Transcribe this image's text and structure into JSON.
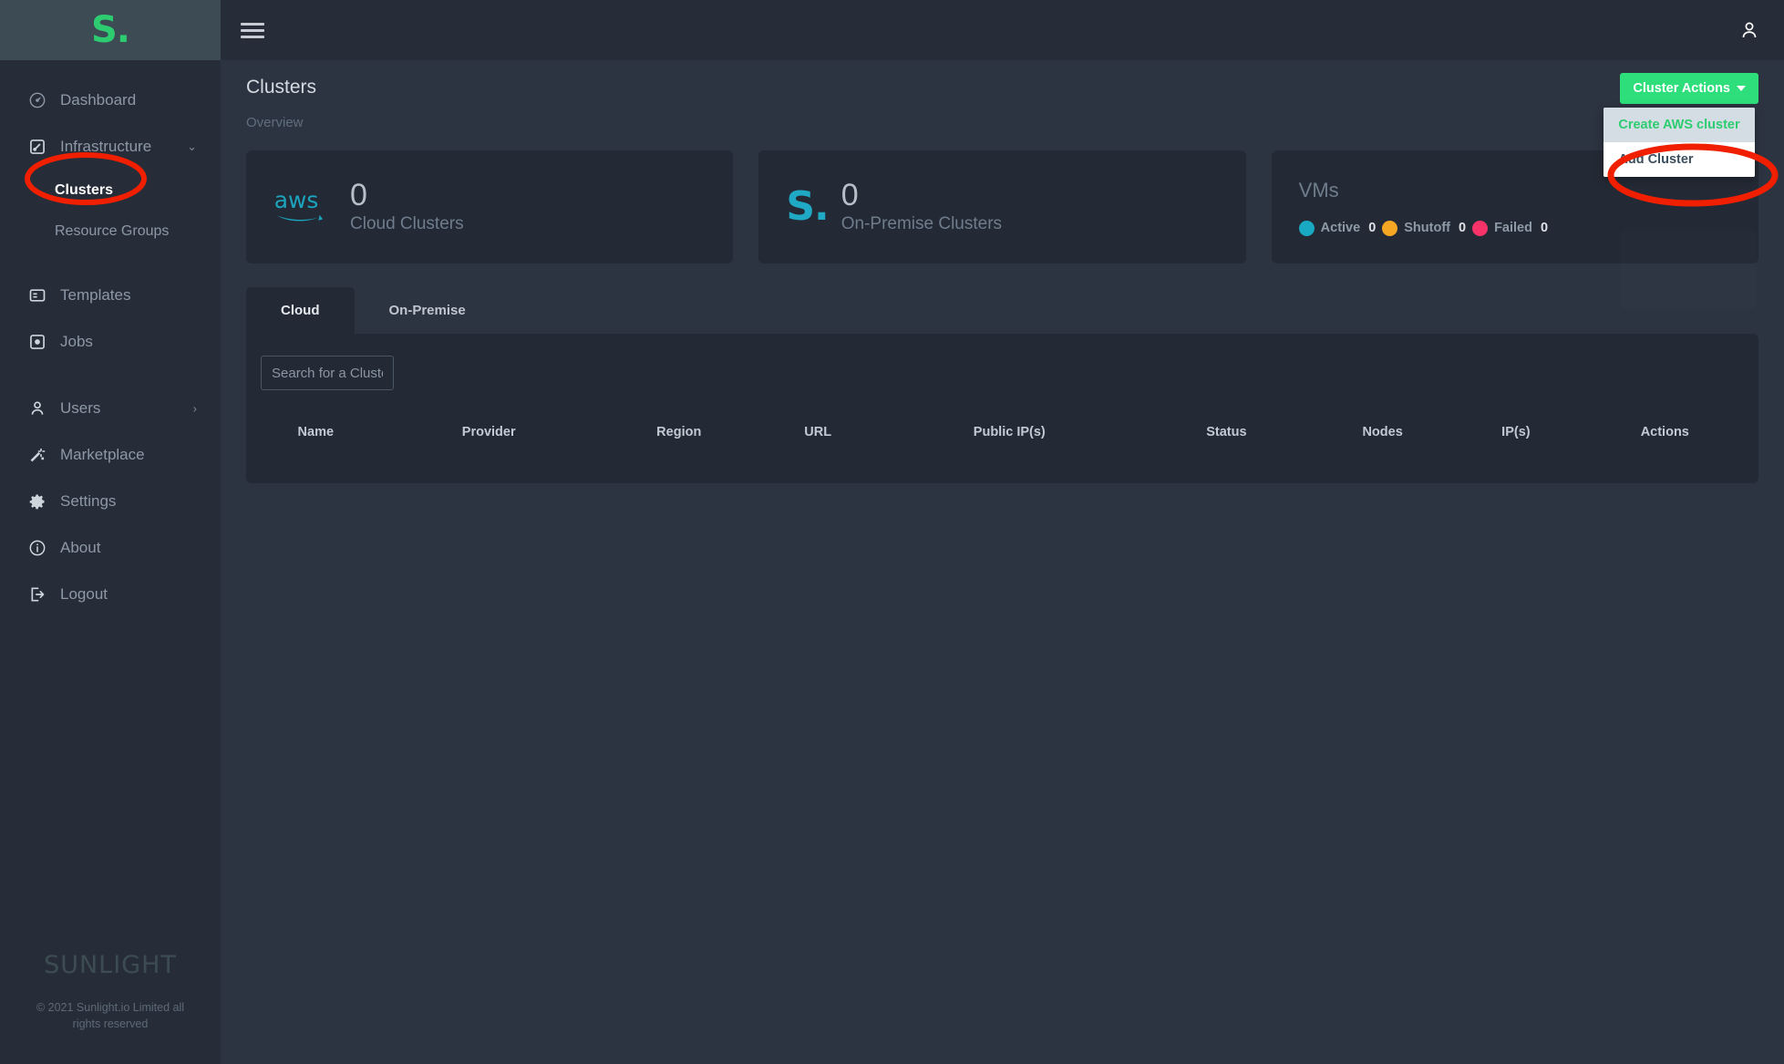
{
  "app": {
    "logo_text": "S.",
    "wordmark": "SUNLIGHT",
    "copyright": "© 2021 Sunlight.io Limited all rights reserved"
  },
  "topbar": {
    "menu_icon": "hamburger-icon",
    "user_icon": "user-icon"
  },
  "sidebar": {
    "items": [
      {
        "label": "Dashboard",
        "icon": "dashboard-icon"
      },
      {
        "label": "Infrastructure",
        "icon": "infrastructure-icon",
        "chevron": "⌄"
      },
      {
        "label": "Templates",
        "icon": "templates-icon"
      },
      {
        "label": "Jobs",
        "icon": "jobs-icon"
      },
      {
        "label": "Users",
        "icon": "users-icon",
        "chevron": "›"
      },
      {
        "label": "Marketplace",
        "icon": "marketplace-icon"
      },
      {
        "label": "Settings",
        "icon": "gear-icon"
      },
      {
        "label": "About",
        "icon": "info-icon"
      },
      {
        "label": "Logout",
        "icon": "logout-icon"
      }
    ],
    "sub_items": [
      {
        "label": "Clusters",
        "active": true
      },
      {
        "label": "Resource Groups",
        "active": false
      }
    ]
  },
  "page": {
    "title": "Clusters",
    "breadcrumb": "Overview"
  },
  "cluster_actions": {
    "button_label": "Cluster Actions",
    "button_color": "#2ede7b",
    "menu": [
      {
        "label": "Create AWS cluster",
        "state": "hovered",
        "text_color": "#2ecc71",
        "bg_color": "#d3dde3"
      },
      {
        "label": "Add Cluster",
        "state": "default",
        "text_color": "#3c4f5e",
        "bg_color": "#ffffff"
      }
    ]
  },
  "cards": [
    {
      "icon": "aws-logo-icon",
      "value": "0",
      "label": "Cloud Clusters",
      "accent": "#1ba4bd"
    },
    {
      "icon": "sunlight-s-icon",
      "value": "0",
      "label": "On-Premise Clusters",
      "accent": "#1fa9c4"
    }
  ],
  "vm_card": {
    "title": "VMs",
    "stats": [
      {
        "name": "Active",
        "count": "0",
        "color": "#1aa9c2"
      },
      {
        "name": "Shutoff",
        "count": "0",
        "color": "#f5a623"
      },
      {
        "name": "Failed",
        "count": "0",
        "color": "#f8336a"
      }
    ]
  },
  "tabs": [
    {
      "label": "Cloud",
      "active": true
    },
    {
      "label": "On-Premise",
      "active": false
    }
  ],
  "search": {
    "placeholder": "Search for a Cluster",
    "value": ""
  },
  "table": {
    "columns": [
      "Name",
      "Provider",
      "Region",
      "URL",
      "Public IP(s)",
      "Status",
      "Nodes",
      "IP(s)",
      "Actions"
    ],
    "rows": []
  },
  "annotations": [
    {
      "name": "clusters-highlight",
      "target": "Clusters",
      "color": "#f01f00",
      "shape": "ellipse"
    },
    {
      "name": "add-cluster-highlight",
      "target": "Add Cluster",
      "color": "#f01f00",
      "shape": "ellipse"
    }
  ]
}
